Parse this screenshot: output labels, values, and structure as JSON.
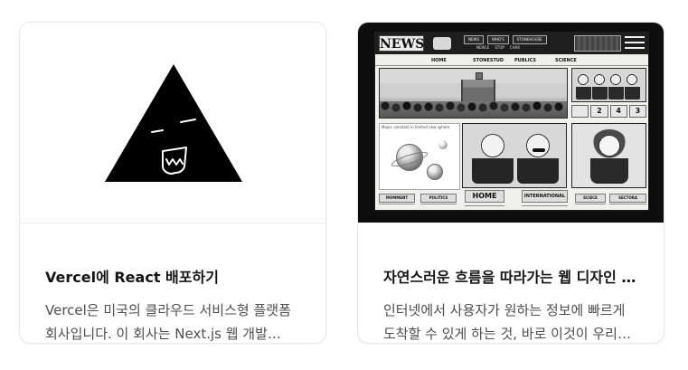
{
  "cards": [
    {
      "title": "Vercel에 React 배포하기",
      "description": "Vercel은 미국의 클라우드 서비스형 플랫폼 회사입니다. 이 회사는 Next.js 웹 개발…",
      "thumbnail": {
        "icon": "vercel-triangle-icon"
      }
    },
    {
      "title": "자연스러운 흐름을 따라가는 웹 디자인 …",
      "description": "인터넷에서 사용자가 원하는 정보에 빠르게 도착할 수 있게 하는 것, 바로 이것이 우리…",
      "thumbnail": {
        "masthead": "NEWS",
        "menu": [
          "NEWS",
          "WHO'S",
          "STONEHOUSE"
        ],
        "submenu": [
          "NEWLE",
          "STOP",
          "CHAR"
        ],
        "nav": [
          "HOME",
          "STONESTUD",
          "PUBLICS",
          "SCIENCE"
        ],
        "space_caption": "Moon: constant in limited new sphere",
        "numbers": [
          "",
          "2",
          "4",
          "3"
        ],
        "labels": [
          "MOMMENT",
          "POLITICS",
          "HOME",
          "INTERNATIONAL",
          "SCIECE",
          "SECTORA"
        ]
      }
    }
  ],
  "colors": {
    "page_bg": "#ffffff",
    "card_border": "#e7e7e7",
    "title": "#151515",
    "body": "#4e4e4e",
    "news_bg": "#0d0d0d"
  }
}
